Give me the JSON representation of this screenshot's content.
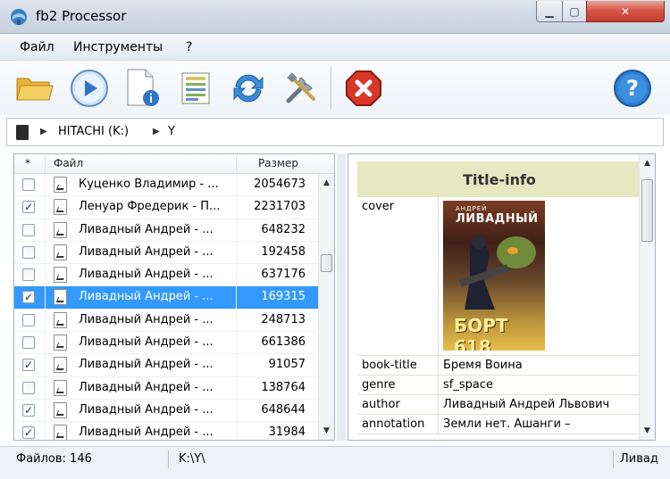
{
  "window": {
    "title": "fb2 Processor"
  },
  "menu": {
    "items": [
      "Файл",
      "Инструменты",
      "?"
    ]
  },
  "path": {
    "drive": "HITACHI (K:)",
    "folder": "Y"
  },
  "list": {
    "columns": {
      "check": "*",
      "file": "Файл",
      "size": "Размер"
    },
    "rows": [
      {
        "checked": false,
        "selected": false,
        "name": "Куценко Владимир - ...",
        "size": "2054673"
      },
      {
        "checked": true,
        "selected": false,
        "name": "Ленуар Фредерик - П...",
        "size": "2231703"
      },
      {
        "checked": false,
        "selected": false,
        "name": "Ливадный Андрей - ...",
        "size": "648232"
      },
      {
        "checked": false,
        "selected": false,
        "name": "Ливадный Андрей - ...",
        "size": "192458"
      },
      {
        "checked": false,
        "selected": false,
        "name": "Ливадный Андрей - ...",
        "size": "637176"
      },
      {
        "checked": true,
        "selected": true,
        "name": "Ливадный Андрей - ...",
        "size": "169315"
      },
      {
        "checked": false,
        "selected": false,
        "name": "Ливадный Андрей - ...",
        "size": "248713"
      },
      {
        "checked": false,
        "selected": false,
        "name": "Ливадный Андрей - ...",
        "size": "661386"
      },
      {
        "checked": true,
        "selected": false,
        "name": "Ливадный Андрей - ...",
        "size": "91057"
      },
      {
        "checked": false,
        "selected": false,
        "name": "Ливадный Андрей - ...",
        "size": "138764"
      },
      {
        "checked": true,
        "selected": false,
        "name": "Ливадный Андрей - ...",
        "size": "648644"
      },
      {
        "checked": true,
        "selected": false,
        "name": "Ливадный Андрей - ...",
        "size": "31984"
      }
    ]
  },
  "info": {
    "header": "Title-info",
    "cover_label": "cover",
    "cover_image": {
      "author": "АНДРЕЙ",
      "name": "ЛИВАДНЫЙ",
      "book": "БОРТ 618"
    },
    "fields": [
      {
        "key": "book-title",
        "value": "Бремя Воина"
      },
      {
        "key": "genre",
        "value": "sf_space"
      },
      {
        "key": "author",
        "value": "Ливадный Андрей Львович"
      },
      {
        "key": "annotation",
        "value": "Земли нет. Ашанги –"
      }
    ]
  },
  "status": {
    "files": "Файлов: 146",
    "path": "K:\\Y\\",
    "extra": "Ливад"
  },
  "colors": {
    "selection": "#3399ff",
    "info_header": "#e5e8c0",
    "close": "#d6584a"
  }
}
